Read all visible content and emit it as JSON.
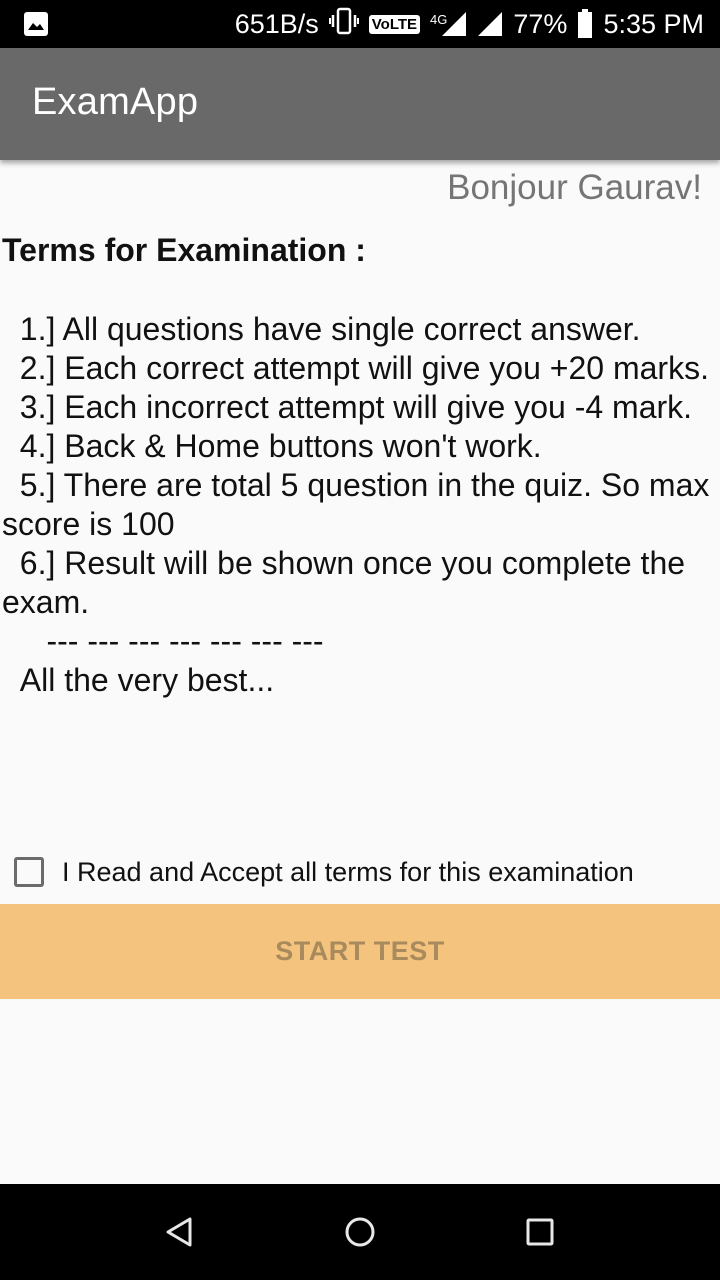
{
  "status_bar": {
    "net_speed": "651B/s",
    "volte": "VoLTE",
    "network": "4G",
    "battery": "77%",
    "time": "5:35 PM"
  },
  "app_bar": {
    "title": "ExamApp"
  },
  "greeting": "Bonjour Gaurav!",
  "terms": {
    "heading": "Terms for Examination :",
    "body": "  1.] All questions have single correct answer.\n  2.] Each correct attempt will give you +20 marks.\n  3.] Each incorrect attempt will give you -4 mark.\n  4.] Back & Home buttons won't work.\n  5.] There are total 5 question in the quiz. So max score is 100\n  6.] Result will be shown once you complete the exam.\n     --- --- --- --- --- --- ---\n  All the very best..."
  },
  "accept": {
    "label": "I Read and Accept all terms for this examination",
    "checked": false
  },
  "start_button": {
    "label": "START TEST",
    "color": "#f4c47f"
  },
  "nav_bar": {
    "icons": [
      "back-icon",
      "home-icon",
      "recents-icon"
    ]
  }
}
